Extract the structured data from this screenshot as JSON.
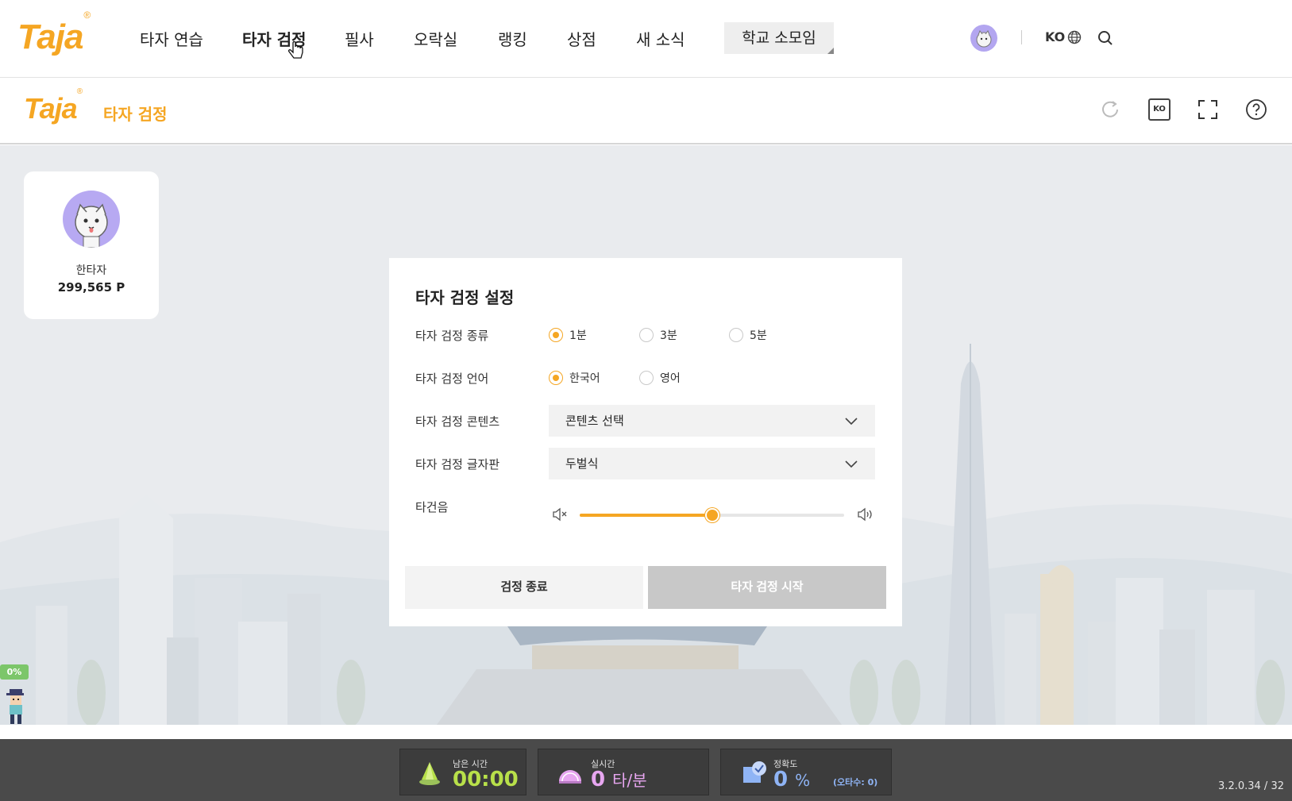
{
  "nav": {
    "logo": "Taja",
    "items": [
      "타자 연습",
      "타자 검정",
      "필사",
      "오락실",
      "랭킹",
      "상점",
      "새 소식"
    ],
    "school": "학교 소모임",
    "lang": "KO"
  },
  "subheader": {
    "logo": "Taja",
    "title": "타자 검정",
    "lang_badge": "KO"
  },
  "profile": {
    "name": "한타자",
    "points": "299,565 P"
  },
  "dialog": {
    "title": "타자 검정 설정",
    "type_label": "타자 검정 종류",
    "type_options": [
      "1분",
      "3분",
      "5분"
    ],
    "type_selected": "1분",
    "language_label": "타자 검정 언어",
    "language_options": [
      "한국어",
      "영어"
    ],
    "language_selected": "한국어",
    "content_label": "타자 검정 콘텐츠",
    "content_value": "콘텐츠 선택",
    "keyboard_label": "타자 검정 글자판",
    "keyboard_value": "두벌식",
    "sound_label": "타건음",
    "sound_volume": 0.5,
    "end_button": "검정 종료",
    "start_button": "타자 검정 시작"
  },
  "progress": "0%",
  "stats": {
    "time_label": "남은 시간",
    "time_value": "00:00",
    "speed_label": "실시간",
    "speed_value": "0",
    "speed_unit": "타/분",
    "accuracy_label": "정확도",
    "accuracy_value": "0",
    "accuracy_unit": "%",
    "typo": "(오타수: 0)"
  },
  "version": "3.2.0.34 / 32",
  "colors": {
    "brand": "#f5a623",
    "nav_highlight": "#7fd3cf",
    "time_green": "#b8e04a",
    "speed_pink": "#e7a6f0",
    "accuracy_blue": "#8fb4f5"
  }
}
